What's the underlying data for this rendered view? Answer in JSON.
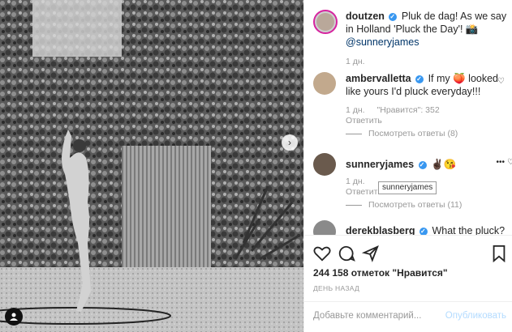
{
  "post": {
    "author": "doutzen",
    "caption_text": " Pluk de dag! As we say in Holland 'Pluck the Day'! 📸",
    "caption_mention": "@sunneryjames",
    "time": "1 дн."
  },
  "comments": [
    {
      "user": "ambervalletta",
      "text": " If my 🍑 looked like yours I'd pluck everyday!!!",
      "time": "1 дн.",
      "likes": "\"Нравится\": 352",
      "reply_label": "Ответить",
      "view_replies": "Посмотреть ответы (8)"
    },
    {
      "user": "sunneryjames",
      "text": " ✌🏿😘",
      "time": "1 дн.",
      "likes": "",
      "reply_label": "Ответить",
      "view_replies": "Посмотреть ответы (11)"
    },
    {
      "user": "derekblasberg",
      "text": " What the pluck?"
    }
  ],
  "tooltip": "sunneryjames",
  "actions": {
    "like_icon": "heart-icon",
    "comment_icon": "comment-icon",
    "share_icon": "share-icon",
    "save_icon": "bookmark-icon"
  },
  "stats": {
    "likes": "244 158 отметок \"Нравится\"",
    "date": "ДЕНЬ НАЗАД"
  },
  "add_comment": {
    "placeholder": "Добавьте комментарий...",
    "publish": "Опубликовать"
  }
}
